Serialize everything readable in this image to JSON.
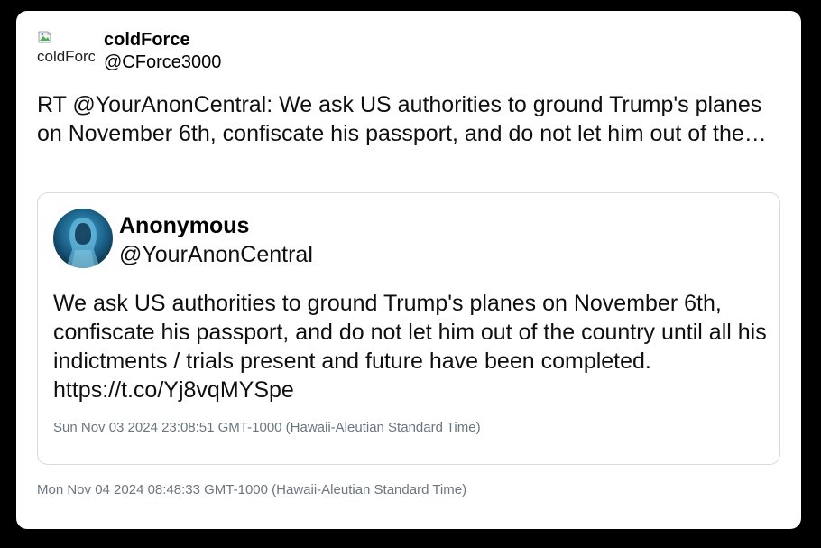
{
  "tweet": {
    "author": {
      "display_name": "coldForce",
      "handle": "@CForce3000",
      "avatar_alt": "coldForce"
    },
    "text": "RT @YourAnonCentral: We ask US authorities to ground Trump's planes on November 6th, confiscate his passport, and do not let him out of the…",
    "timestamp": "Mon Nov 04 2024 08:48:33 GMT-1000 (Hawaii-Aleutian Standard Time)"
  },
  "quoted_tweet": {
    "author": {
      "display_name": "Anonymous",
      "handle": "@YourAnonCentral",
      "avatar_icon": "hooded-figure-avatar"
    },
    "text": "We ask US authorities to ground Trump's planes on November 6th, confiscate his passport, and do not let him out of the country until all his indictments / trials present and future have been completed. https://t.co/Yj8vqMYSpe",
    "timestamp": "Sun Nov 03 2024 23:08:51 GMT-1000 (Hawaii-Aleutian Standard Time)"
  },
  "colors": {
    "page_background": "#000000",
    "card_background": "#ffffff",
    "meta_text": "#6b7580",
    "quote_border": "#d6dbe0"
  }
}
